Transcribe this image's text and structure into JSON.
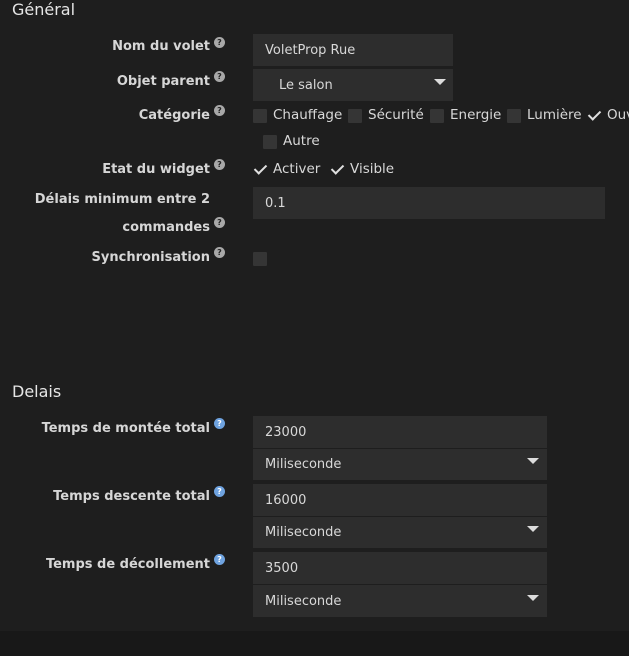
{
  "general": {
    "title": "Général",
    "name_label": "Nom du volet",
    "name_value": "VoletProp Rue",
    "parent_label": "Objet parent",
    "parent_value": "Le salon",
    "category_label": "Catégorie",
    "categories": [
      "Chauffage",
      "Sécurité",
      "Energie",
      "Lumière",
      "Ouv",
      "Autre"
    ],
    "widget_label": "Etat du widget",
    "widget_options": [
      "Activer",
      "Visible"
    ],
    "delay_label_line1": "Délais minimum entre 2",
    "delay_label_line2": "commandes",
    "delay_value": "0.1",
    "sync_label": "Synchronisation"
  },
  "delais": {
    "title": "Delais",
    "rise_label": "Temps de montée total",
    "rise_value": "23000",
    "rise_unit": "Miliseconde",
    "descent_label": "Temps descente total",
    "descent_value": "16000",
    "descent_unit": "Miliseconde",
    "takeoff_label": "Temps de décollement",
    "takeoff_value": "3500",
    "takeoff_unit": "Miliseconde"
  },
  "help_glyph": "?"
}
